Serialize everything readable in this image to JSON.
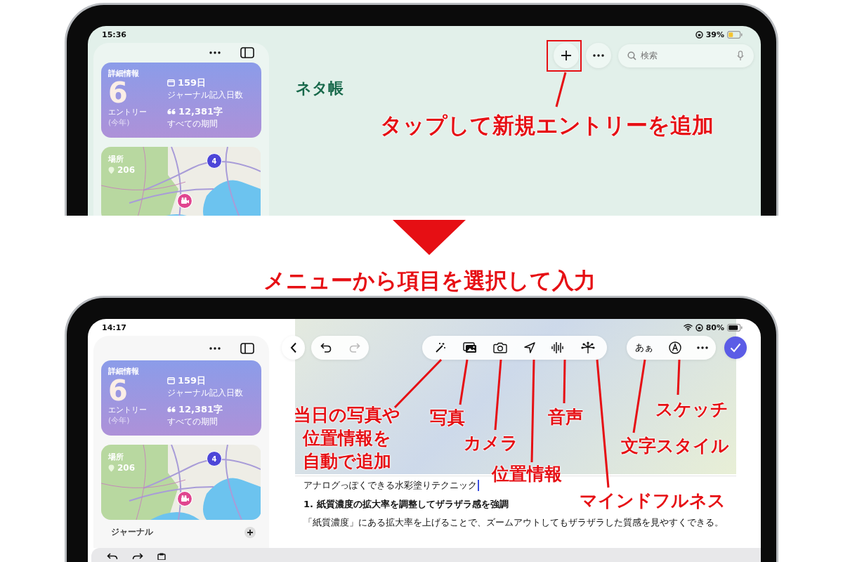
{
  "top_screen": {
    "status_bar": {
      "time": "15:36",
      "battery": "39%"
    },
    "sidebar": {
      "insights": {
        "title": "詳細情報",
        "count": "6",
        "count_label": "エントリー",
        "period": "(今年)",
        "stats": [
          {
            "kind": "calendar",
            "value": "159日",
            "label": "ジャーナル記入日数"
          },
          {
            "kind": "quote",
            "value": "12,381字",
            "label": "すべての期間"
          }
        ]
      },
      "places": {
        "title": "場所",
        "count": "206",
        "cluster": "4"
      }
    },
    "journal_title": "ネタ帳",
    "search": {
      "placeholder": "検索"
    }
  },
  "top_annotation": "タップして新規エントリーを追加",
  "transition_caption": "メニューから項目を選択して入力",
  "bottom_screen": {
    "status_bar": {
      "time": "14:17",
      "battery": "80%"
    },
    "sidebar": {
      "insights": {
        "title": "詳細情報",
        "count": "6",
        "count_label": "エントリー",
        "period": "(今年)",
        "stats": [
          {
            "kind": "calendar",
            "value": "159日",
            "label": "ジャーナル記入日数"
          },
          {
            "kind": "quote",
            "value": "12,381字",
            "label": "すべての期間"
          }
        ]
      },
      "places": {
        "title": "場所",
        "count": "206",
        "cluster": "4"
      },
      "section_title": "ジャーナル"
    },
    "toolbar": [
      {
        "kind": "auto"
      },
      {
        "kind": "photo"
      },
      {
        "kind": "camera"
      },
      {
        "kind": "location"
      },
      {
        "kind": "audio"
      },
      {
        "kind": "mindfulness"
      }
    ],
    "text_style_button": "あぁ",
    "entry": {
      "title": "アナログっぽくできる水彩塗りテクニック",
      "heading": "1. 紙質濃度の拡大率を調整してザラザラ感を強調",
      "paragraph": "「紙質濃度」にある拡大率を上げることで、ズームアウトしてもザラザラした質感を見やすくできる。"
    }
  },
  "callouts": [
    {
      "lines": [
        "当日の写真や",
        "位置情報を",
        "自動で追加"
      ]
    },
    {
      "lines": [
        "写真"
      ]
    },
    {
      "lines": [
        "音声"
      ]
    },
    {
      "lines": [
        "スケッチ"
      ]
    },
    {
      "lines": [
        "カメラ"
      ]
    },
    {
      "lines": [
        "文字スタイル"
      ]
    },
    {
      "lines": [
        "位置情報"
      ]
    },
    {
      "lines": [
        "マインドフルネス"
      ]
    }
  ]
}
